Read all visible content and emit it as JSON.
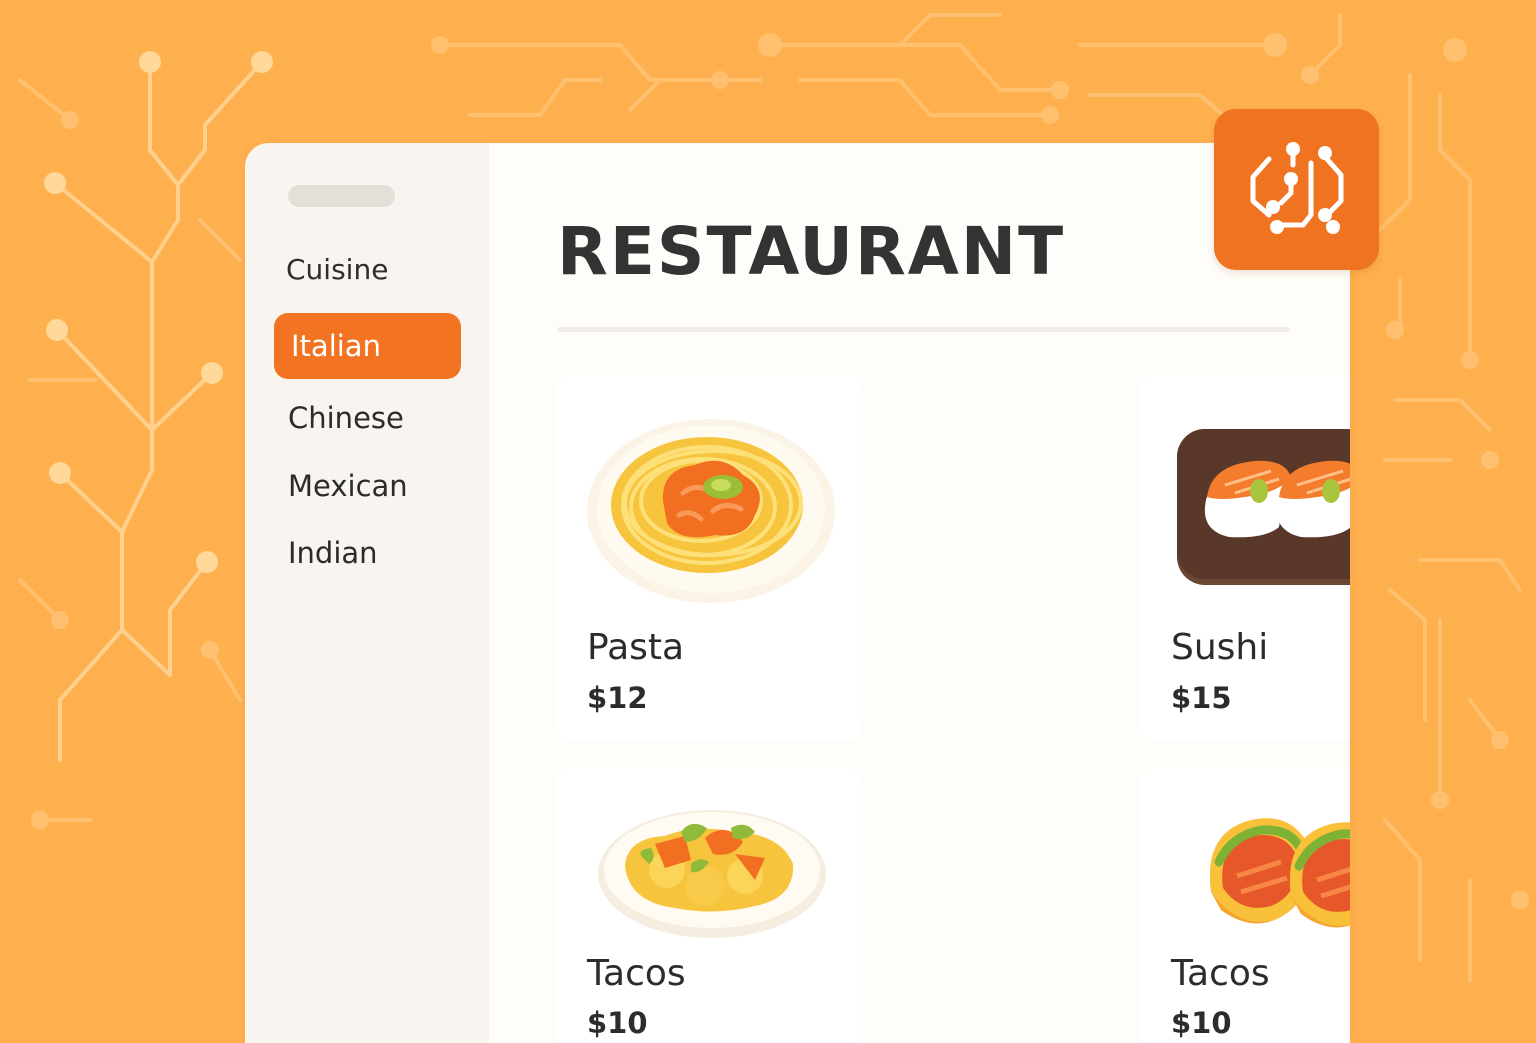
{
  "app": {
    "title": "RESTAURANT",
    "icon": "circuit-chip-icon",
    "accent_color": "#f27321",
    "background_color": "#ffb04e"
  },
  "sidebar": {
    "heading": "Cuisine",
    "items": [
      {
        "label": "Italian",
        "active": true
      },
      {
        "label": "Chinese",
        "active": false
      },
      {
        "label": "Mexican",
        "active": false
      },
      {
        "label": "Indian",
        "active": false
      }
    ]
  },
  "menu": {
    "items": [
      {
        "name": "Pasta",
        "price": "$12",
        "image": "pasta-plate-image"
      },
      {
        "name": "Sushi",
        "price": "$15",
        "image": "sushi-board-image"
      },
      {
        "name": "Tacos",
        "price": "$10",
        "image": "tacos-plate-image"
      },
      {
        "name": "Tacos",
        "price": "$10",
        "image": "tacos-trio-image"
      }
    ]
  }
}
